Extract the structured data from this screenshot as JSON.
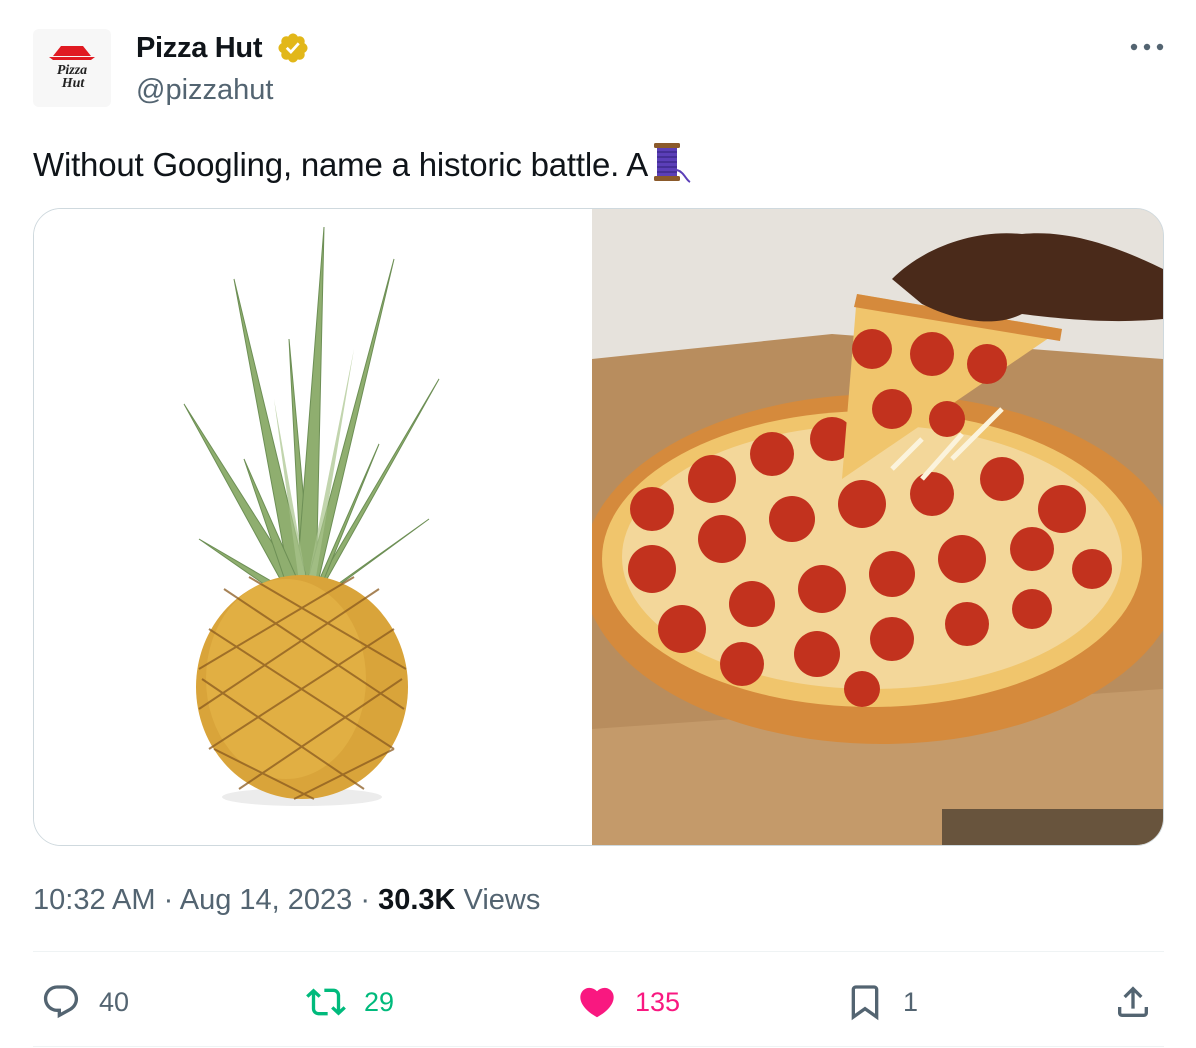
{
  "tweet": {
    "author": {
      "display_name": "Pizza Hut",
      "handle": "@pizzahut",
      "verified": true,
      "avatar_text": [
        "Pizza",
        "Hut"
      ]
    },
    "text": "Without Googling, name a historic battle.  A",
    "emoji_icon": "thread-spool-emoji",
    "media": [
      {
        "icon": "pineapple-image"
      },
      {
        "icon": "pepperoni-pizza-image"
      }
    ],
    "time": "10:32 AM",
    "separator": "·",
    "date": "Aug 14, 2023",
    "views_count": "30.3K",
    "views_label": "Views"
  },
  "actions": {
    "reply": {
      "count": "40",
      "color": "#536471"
    },
    "retweet": {
      "count": "29",
      "color": "#00ba7c"
    },
    "like": {
      "count": "135",
      "color": "#f91880"
    },
    "bookmark": {
      "count": "1",
      "color": "#536471"
    },
    "share": {
      "color": "#536471"
    }
  },
  "colors": {
    "text": "#0f1419",
    "secondary": "#536471",
    "verified_gold": "#e2b719",
    "border": "#cfd9de"
  }
}
